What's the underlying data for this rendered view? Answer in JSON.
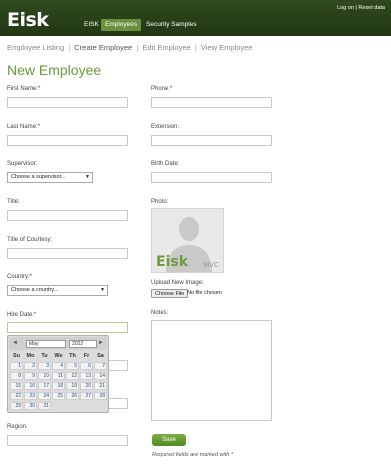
{
  "header": {
    "logo": "Eisk",
    "nav": [
      "EISK",
      "Employees",
      "Security Samples"
    ],
    "active_nav": "Employees",
    "top_links": {
      "login": "Log on",
      "sep": "|",
      "reset": "Reset data"
    }
  },
  "subnav": {
    "items": [
      "Employee Listing",
      "Create Employee",
      "Edit Employee",
      "View Employee"
    ],
    "separator": "|"
  },
  "page_title": "New Employee",
  "form": {
    "first_name": "First Name:*",
    "last_name": "Last Name:*",
    "supervisor": "Supervisor:",
    "supervisor_value": "Choose a supervisor...",
    "title": "Title:",
    "title_courtesy": "Title of Courtesy:",
    "country": "Country:*",
    "country_value": "Choose a country...",
    "hire_date": "Hire Date:*",
    "region": "Region:",
    "phone": "Phone:*",
    "extension": "Extension:",
    "birth_date": "Birth Date:",
    "photo": "Photo:",
    "upload": "Upload New Image:",
    "choose_file": "Choose File",
    "no_file": "No file chosen",
    "notes": "Notes:",
    "save": "Save",
    "required_note": "Required fields are marked with *",
    "photo_logo": "Eisk",
    "photo_mvc": "MVC"
  },
  "datepicker": {
    "month": "May",
    "year": "2022",
    "prev": "◄",
    "next": "►",
    "dow": [
      "Su",
      "Mo",
      "Tu",
      "We",
      "Th",
      "Fr",
      "Sa"
    ],
    "weeks": [
      [
        "1",
        "2",
        "3",
        "4",
        "5",
        "6",
        "7"
      ],
      [
        "8",
        "9",
        "10",
        "11",
        "12",
        "13",
        "14"
      ],
      [
        "15",
        "16",
        "17",
        "18",
        "19",
        "20",
        "21"
      ],
      [
        "22",
        "23",
        "24",
        "25",
        "26",
        "27",
        "28"
      ],
      [
        "29",
        "30",
        "31",
        "",
        "",
        "",
        ""
      ]
    ]
  },
  "colors": {
    "header": "#2f4a1e",
    "accent": "#6a9a3c",
    "link": "#1f4f8f"
  }
}
